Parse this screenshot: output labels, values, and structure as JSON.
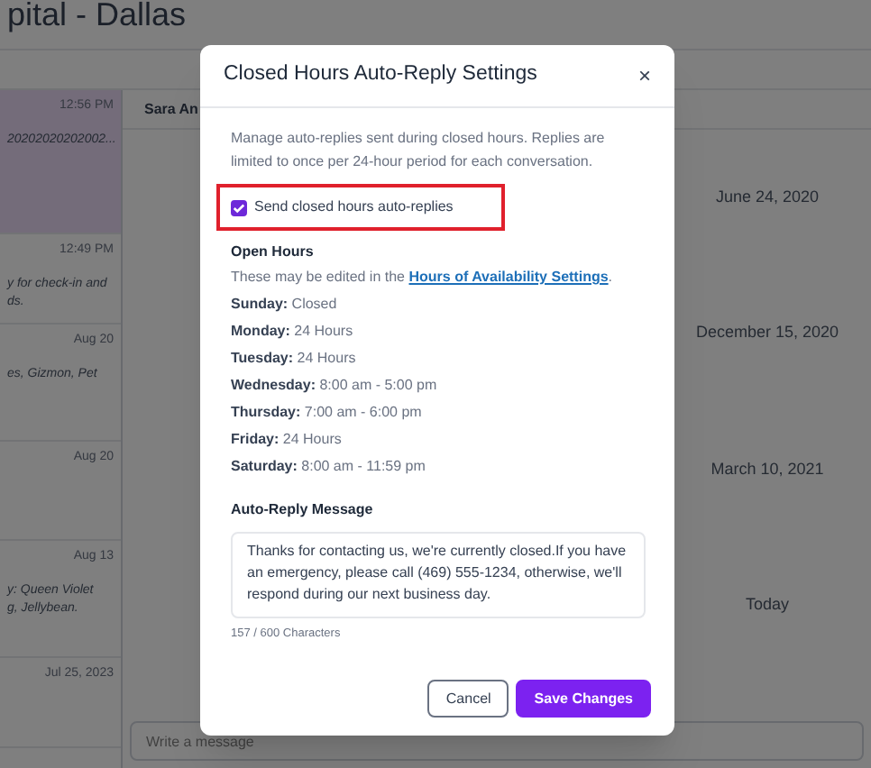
{
  "app": {
    "title": "pital - Dallas"
  },
  "conversations": [
    {
      "time": "12:56 PM",
      "lines": [
        "20202020202002..."
      ],
      "selected": true
    },
    {
      "time": "12:49 PM",
      "lines": [
        "y for check-in and",
        "ds."
      ],
      "selected": false
    },
    {
      "time": "Aug 20",
      "lines": [
        "es, Gizmon, Pet"
      ],
      "selected": false
    },
    {
      "time": "Aug 20",
      "selected": false
    },
    {
      "time": "Aug 13",
      "lines": [
        "y: Queen Violet",
        "g, Jellybean."
      ],
      "selected": false
    },
    {
      "time": "Jul 25, 2023",
      "selected": false
    }
  ],
  "chat": {
    "contact": "Sara An",
    "dates": [
      "June 24, 2020",
      "December 15, 2020",
      "March 10, 2021",
      "Today"
    ],
    "composer": {
      "placeholder": "Write a message"
    }
  },
  "dialog": {
    "title": "Closed Hours Auto-Reply Settings",
    "close": "×",
    "description": "Manage auto-replies sent during closed hours. Replies are limited to once per 24-hour period for each conversation.",
    "checkbox": {
      "label": "Send closed hours auto-replies",
      "checked": true,
      "highlighted": true
    },
    "open_hours": {
      "heading": "Open Hours",
      "note": "These may be edited in the",
      "link": "Hours of Availability Settings",
      "note_end": ".",
      "days": [
        {
          "day": "Sunday:",
          "hours": "Closed"
        },
        {
          "day": "Monday:",
          "hours": "24 Hours"
        },
        {
          "day": "Tuesday:",
          "hours": "24 Hours"
        },
        {
          "day": "Wednesday:",
          "hours": "8:00 am - 5:00 pm"
        },
        {
          "day": "Thursday:",
          "hours": "7:00 am - 6:00 pm"
        },
        {
          "day": "Friday:",
          "hours": "24 Hours"
        },
        {
          "day": "Saturday:",
          "hours": "8:00 am - 11:59 pm"
        }
      ]
    },
    "message": {
      "label": "Auto-Reply Message",
      "value": "Thanks for contacting us, we're currently closed.If you have an emergency, please call (469) 555-1234, otherwise, we'll respond during our next business day.",
      "counter": "157 / 600 Characters"
    },
    "buttons": [
      {
        "label": "Cancel",
        "kind": "secondary"
      },
      {
        "label": "Save Changes",
        "kind": "primary"
      }
    ]
  }
}
